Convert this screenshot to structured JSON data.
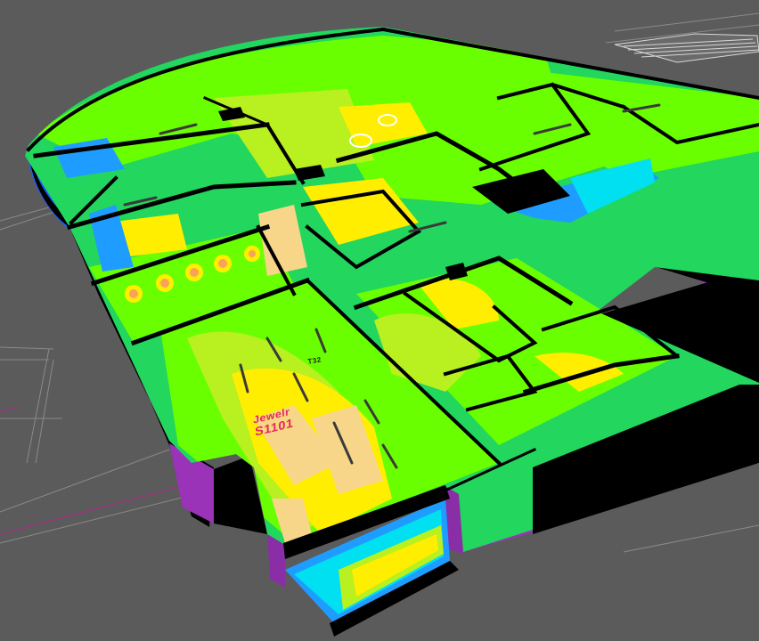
{
  "viewport": {
    "background": "#5b5b5b",
    "view": "3D perspective"
  },
  "model": {
    "room_labels": [
      {
        "name": "Jewelr",
        "code": "S1101"
      }
    ],
    "tag": "T32"
  },
  "false_color_palette": [
    "#1f9cff",
    "#00e0f0",
    "#22d65e",
    "#6aff00",
    "#b8f020",
    "#ffee00",
    "#f7d68a",
    "#ffffff"
  ],
  "wall_colors": {
    "exterior": "#9a33b8",
    "cap": "#000000"
  }
}
